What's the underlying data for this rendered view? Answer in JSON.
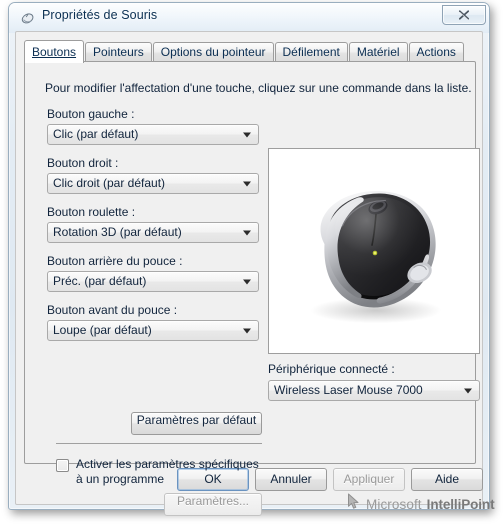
{
  "window": {
    "title": "Propriétés de Souris",
    "icon": "mouse-icon",
    "close_label": "✕"
  },
  "tabs": [
    {
      "label": "Boutons",
      "active": true
    },
    {
      "label": "Pointeurs",
      "active": false
    },
    {
      "label": "Options du pointeur",
      "active": false
    },
    {
      "label": "Défilement",
      "active": false
    },
    {
      "label": "Matériel",
      "active": false
    },
    {
      "label": "Actions",
      "active": false
    }
  ],
  "page": {
    "intro": "Pour modifier l'affectation d'une touche, cliquez sur une commande dans la liste.",
    "buttons_config": [
      {
        "label": "Bouton gauche :",
        "value": "Clic (par défaut)"
      },
      {
        "label": "Bouton droit :",
        "value": "Clic droit (par défaut)"
      },
      {
        "label": "Bouton roulette :",
        "value": "Rotation 3D (par défaut)"
      },
      {
        "label": "Bouton arrière du pouce :",
        "value": "Préc. (par défaut)"
      },
      {
        "label": "Bouton avant du pouce :",
        "value": "Loupe (par défaut)"
      }
    ],
    "default_params_label": "Paramètres par défaut",
    "program_specific_label": "Activer les paramètres spécifiques à un programme",
    "program_specific_checked": false,
    "settings_label": "Paramètres...",
    "settings_enabled": false,
    "device_label": "Périphérique connecté :",
    "device_value": "Wireless Laser Mouse 7000",
    "brand_primary": "Microsoft",
    "brand_secondary": "IntelliPoint"
  },
  "dialog_buttons": [
    {
      "name": "ok-button",
      "label": "OK",
      "enabled": true,
      "default": true
    },
    {
      "name": "cancel-button",
      "label": "Annuler",
      "enabled": true,
      "default": false
    },
    {
      "name": "apply-button",
      "label": "Appliquer",
      "enabled": false,
      "default": false
    },
    {
      "name": "help-button",
      "label": "Aide",
      "enabled": true,
      "default": false
    }
  ],
  "colors": {
    "dialog_bg": "#f0f0f0",
    "text": "#11243c",
    "frame_border": "#9aaebf",
    "disabled_text": "#9a9a9a"
  }
}
